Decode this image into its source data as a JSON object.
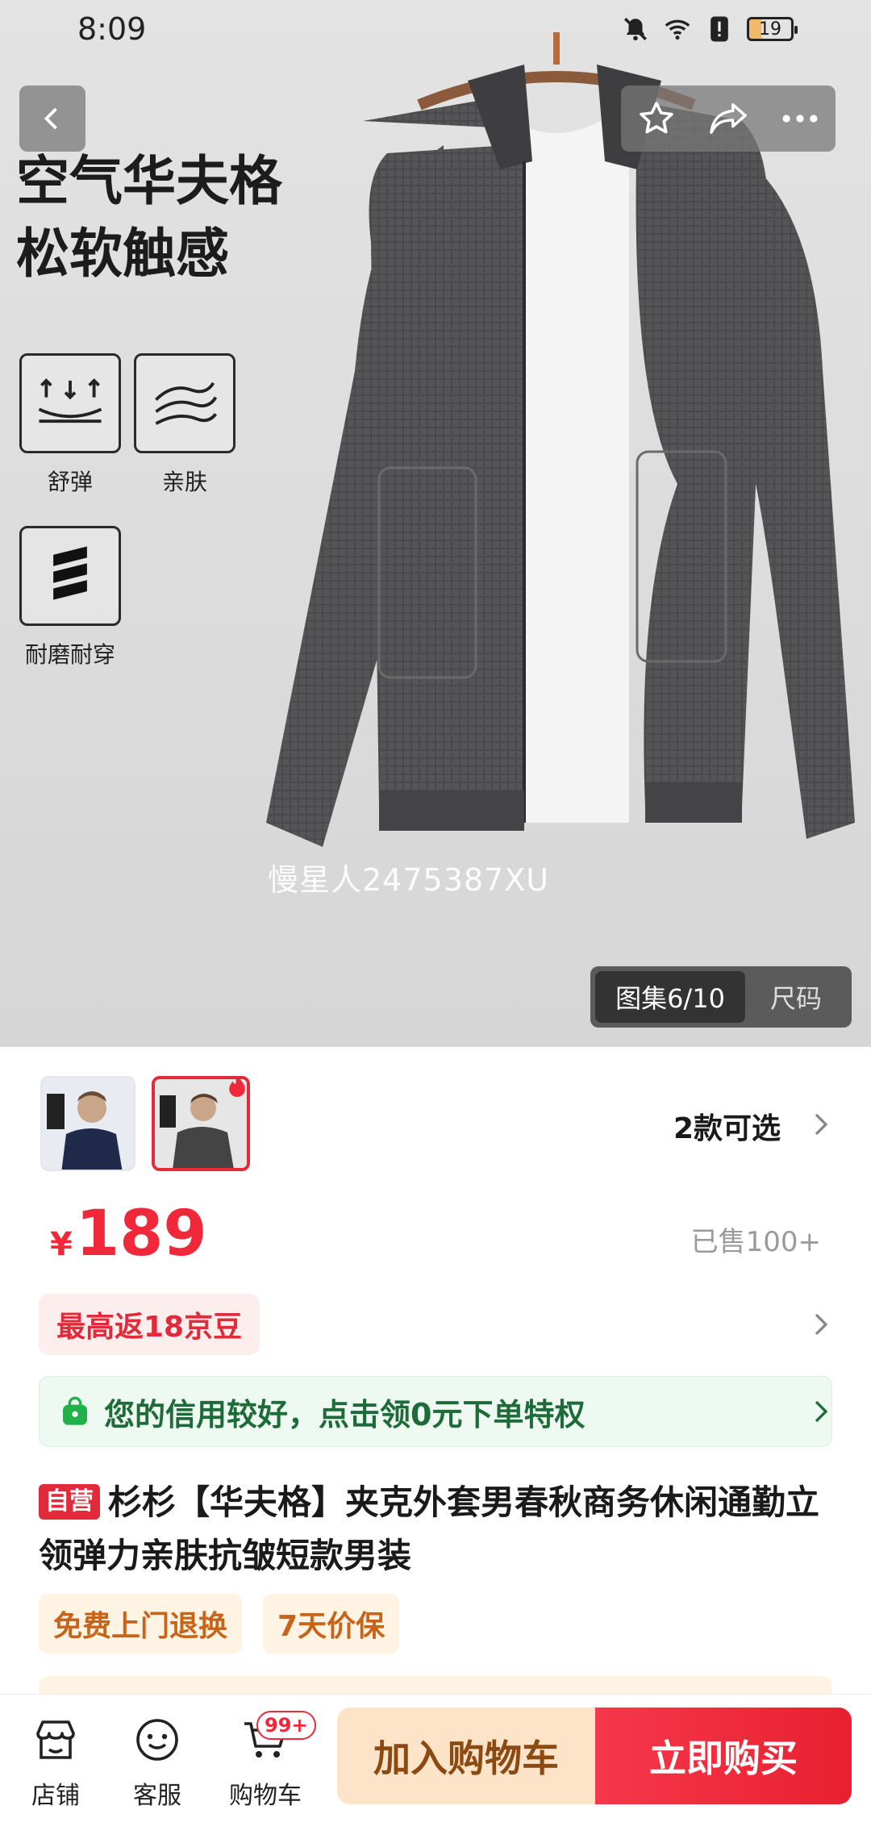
{
  "status_bar": {
    "time": "8:09",
    "battery": "19"
  },
  "hero": {
    "promo_title_line1": "空气华夫格",
    "promo_title_line2": "松软触感",
    "features": [
      {
        "label": "舒弹",
        "icon": "stretch-arrows-icon"
      },
      {
        "label": "亲肤",
        "icon": "soft-wave-icon"
      },
      {
        "label": "耐磨耐穿",
        "icon": "durable-stripes-icon"
      }
    ],
    "watermark": "慢星人2475387XU",
    "gallery_tab": "图集6/10",
    "size_tab": "尺码"
  },
  "variants": {
    "count_label": "2款可选"
  },
  "price": {
    "currency": "¥",
    "amount": "189",
    "sold": "已售100+"
  },
  "rebate": {
    "label": "最高返18京豆"
  },
  "credit": {
    "label": "您的信用较好，点击领0元下单特权"
  },
  "product": {
    "self_badge": "自营",
    "title": "杉杉【华夫格】夹克外套男春秋商务休闲通勤立领弹力亲肤抗皱短款男装"
  },
  "services": [
    "免费上门退换",
    "7天价保"
  ],
  "bottom_bar": {
    "store_label": "店铺",
    "service_label": "客服",
    "cart_label": "购物车",
    "cart_badge": "99+",
    "add_to_cart": "加入购物车",
    "buy_now": "立即购买"
  },
  "colors": {
    "accent_red": "#f0283a",
    "cart_button_bg": "#fde3c8",
    "credit_green": "#1e6b3a"
  }
}
